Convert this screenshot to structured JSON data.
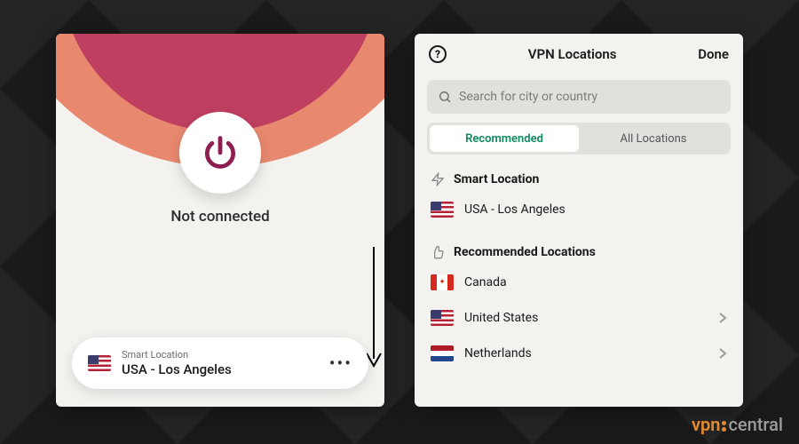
{
  "main": {
    "status": "Not connected",
    "location_card": {
      "label": "Smart Location",
      "value": "USA - Los Angeles"
    }
  },
  "locations": {
    "header": {
      "title": "VPN Locations",
      "done": "Done"
    },
    "search": {
      "placeholder": "Search for city or country"
    },
    "tabs": {
      "recommended": "Recommended",
      "all": "All Locations"
    },
    "smart": {
      "heading": "Smart Location",
      "item": "USA - Los Angeles"
    },
    "recommended": {
      "heading": "Recommended Locations",
      "items": [
        "Canada",
        "United States",
        "Netherlands"
      ]
    }
  },
  "watermark": {
    "left": "vpn",
    "right": "central"
  }
}
